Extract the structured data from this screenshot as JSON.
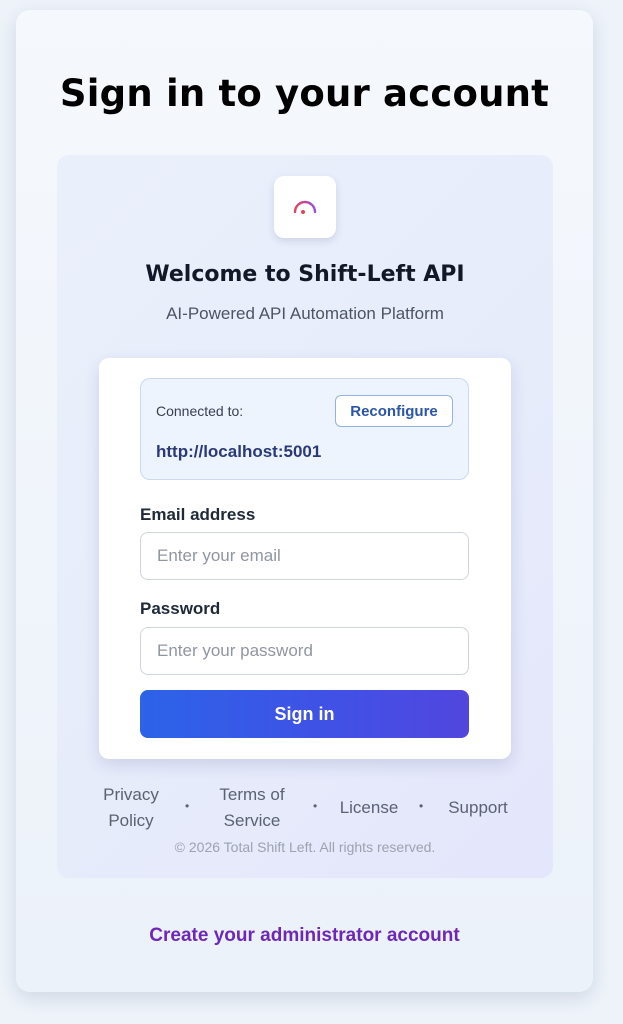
{
  "header": {
    "title": "Sign in to your account"
  },
  "brand": {
    "logo_icon": "gauge-icon",
    "welcome": "Welcome to Shift-Left API",
    "subtitle": "AI-Powered API Automation Platform"
  },
  "connection": {
    "label": "Connected to:",
    "url": "http://localhost:5001",
    "reconfigure_label": "Reconfigure"
  },
  "form": {
    "email_label": "Email address",
    "email_placeholder": "Enter your email",
    "email_value": "",
    "password_label": "Password",
    "password_placeholder": "Enter your password",
    "password_value": "",
    "submit_label": "Sign in"
  },
  "footer": {
    "links": [
      {
        "label_line1": "Privacy",
        "label_line2": "Policy"
      },
      {
        "label_line1": "Terms of",
        "label_line2": "Service"
      },
      {
        "label": "License"
      },
      {
        "label": "Support"
      }
    ],
    "separator": "•",
    "copyright": "© 2026 Total Shift Left. All rights reserved."
  },
  "create_account_link": "Create your administrator account",
  "colors": {
    "accent_start": "#2c63e8",
    "accent_end": "#5146de",
    "link_purple": "#6d28b8"
  }
}
